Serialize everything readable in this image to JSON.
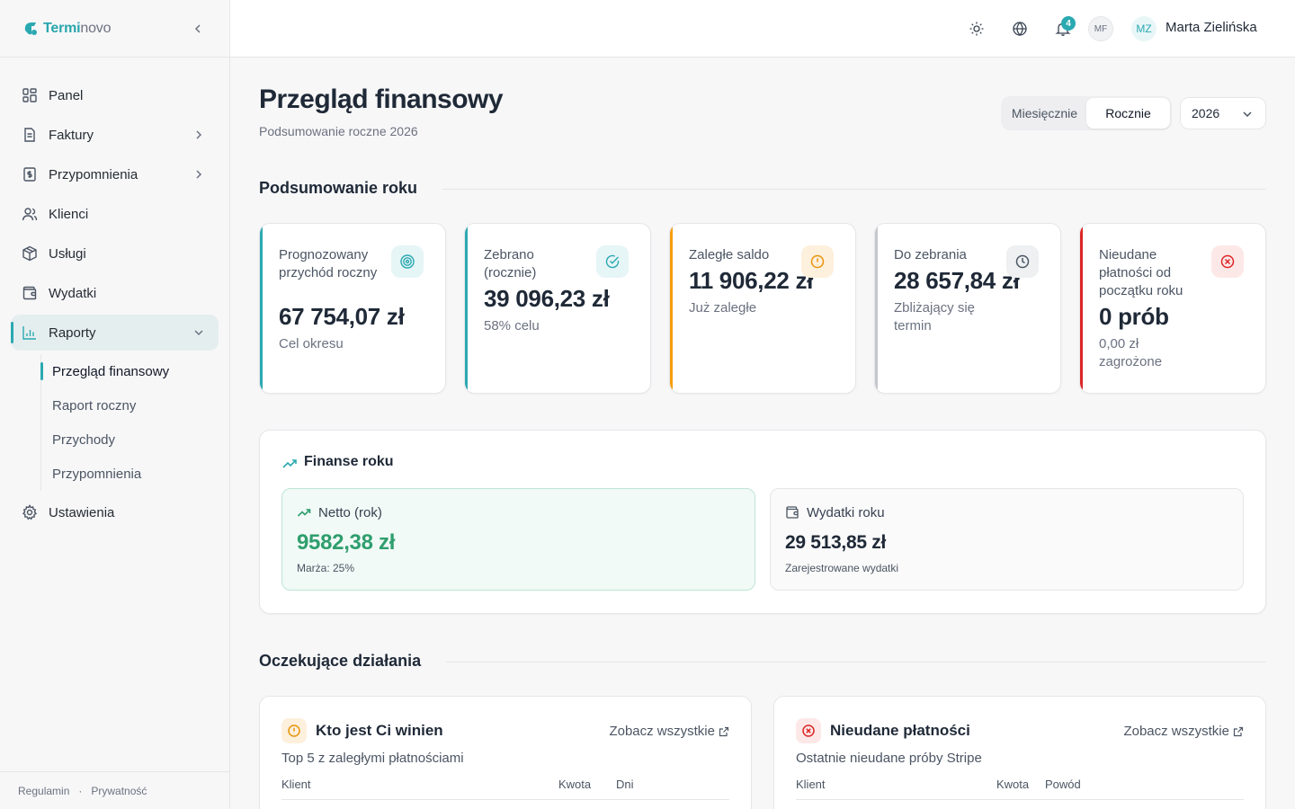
{
  "brand": {
    "name_a": "Termi",
    "name_b": "novo"
  },
  "sidebar": {
    "items": [
      {
        "label": "Panel"
      },
      {
        "label": "Faktury"
      },
      {
        "label": "Przypomnienia"
      },
      {
        "label": "Klienci"
      },
      {
        "label": "Usługi"
      },
      {
        "label": "Wydatki"
      },
      {
        "label": "Raporty"
      },
      {
        "label": "Ustawienia"
      }
    ],
    "subitems": [
      {
        "label": "Przegląd finansowy"
      },
      {
        "label": "Raport roczny"
      },
      {
        "label": "Przychody"
      },
      {
        "label": "Przypomnienia"
      }
    ],
    "footer": {
      "terms": "Regulamin",
      "dot": "·",
      "privacy": "Prywatność"
    }
  },
  "topbar": {
    "notifications_count": "4",
    "avatar_small": "MF",
    "avatar": "MZ",
    "user_name": "Marta Zielińska"
  },
  "header": {
    "title": "Przegląd finansowy",
    "subtitle": "Podsumowanie roczne 2026",
    "period_options": [
      "Miesięcznie",
      "Rocznie"
    ],
    "period_selected": "Rocznie",
    "year": "2026"
  },
  "summary": {
    "title": "Podsumowanie roku",
    "cards": [
      {
        "label": "Prognozowany przychód roczny",
        "value": "67 754,07 zł",
        "note": "Cel okresu",
        "accent": "#2aa9b1",
        "icon": "target-icon"
      },
      {
        "label": "Zebrano (rocznie)",
        "value": "39 096,23 zł",
        "note": "58% celu",
        "accent": "#2aa9b1",
        "icon": "check-circle-icon"
      },
      {
        "label": "Zaległe saldo",
        "value": "11 906,22 zł",
        "note": "Już zaległe",
        "accent": "#f59e0b",
        "icon": "alert-circle-icon"
      },
      {
        "label": "Do zebrania",
        "value": "28 657,84 zł",
        "note": "Zbliżający się termin",
        "accent": "#9ca3af",
        "icon": "clock-icon"
      },
      {
        "label": "Nieudane płatności od początku roku",
        "value": "0 prób",
        "note": "0,00 zł zagrożone",
        "accent": "#dc2626",
        "icon": "x-circle-icon"
      }
    ]
  },
  "finance": {
    "title": "Finanse roku",
    "net": {
      "label": "Netto (rok)",
      "value": "9582,38 zł",
      "note": "Marża: 25%"
    },
    "expenses": {
      "label": "Wydatki roku",
      "value": "29 513,85 zł",
      "note": "Zarejestrowane wydatki"
    }
  },
  "pending": {
    "title": "Oczekujące działania",
    "owed": {
      "title": "Kto jest Ci winien",
      "link": "Zobacz wszystkie",
      "desc": "Top 5 z zaległymi płatnościami",
      "columns": [
        "Klient",
        "Kwota",
        "Dni"
      ]
    },
    "failed": {
      "title": "Nieudane płatności",
      "link": "Zobacz wszystkie",
      "desc": "Ostatnie nieudane próby Stripe",
      "columns": [
        "Klient",
        "Kwota",
        "Powód"
      ]
    }
  },
  "colors": {
    "accent": "#2aa9b1",
    "warning": "#f59e0b",
    "danger": "#dc2626",
    "success": "#2f9e6e"
  }
}
